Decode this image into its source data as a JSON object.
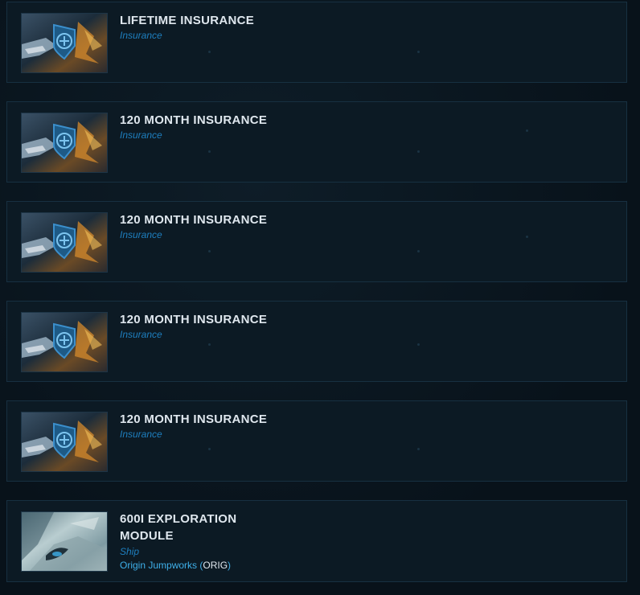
{
  "items": [
    {
      "title": "LIFETIME INSURANCE",
      "type": "Insurance",
      "thumb_icon": "insurance-shield-icon"
    },
    {
      "title": "120 MONTH INSURANCE",
      "type": "Insurance",
      "thumb_icon": "insurance-shield-icon"
    },
    {
      "title": "120 MONTH INSURANCE",
      "type": "Insurance",
      "thumb_icon": "insurance-shield-icon"
    },
    {
      "title": "120 MONTH INSURANCE",
      "type": "Insurance",
      "thumb_icon": "insurance-shield-icon"
    },
    {
      "title": "120 MONTH INSURANCE",
      "type": "Insurance",
      "thumb_icon": "insurance-shield-icon"
    },
    {
      "title_line1": "600I EXPLORATION",
      "title_line2": "MODULE",
      "type": "Ship",
      "manufacturer": "Origin Jumpworks",
      "manufacturer_open": " (",
      "manufacturer_code": "ORIG",
      "manufacturer_close": ")"
    }
  ],
  "colors": {
    "title": "#dfe7ee",
    "type": "#1e7fbf",
    "manufacturer": "#3fb0ea",
    "card_bg": "#0c1a24",
    "card_border": "#173041"
  }
}
